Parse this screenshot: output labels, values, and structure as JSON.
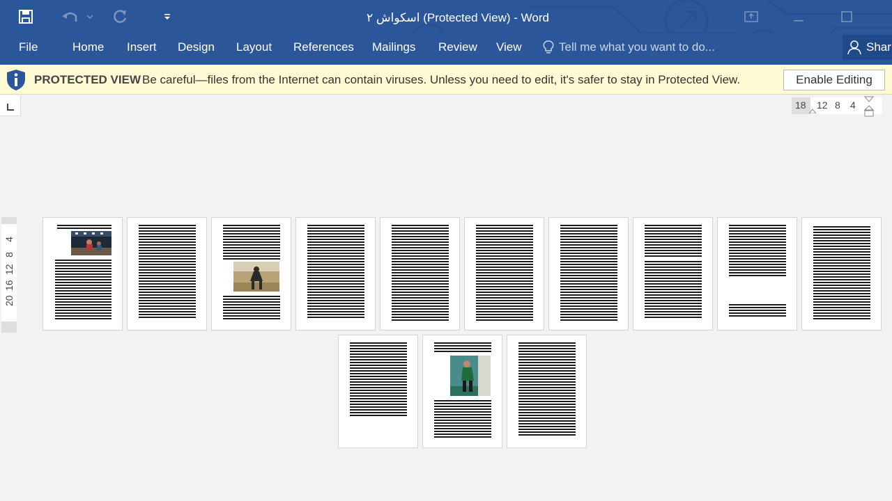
{
  "window": {
    "title": "اسکواش ۲ (Protected View) - Word",
    "colors": {
      "ribbon": "#2b579a",
      "protected_bar": "#fffbd5",
      "canvas": "#f2f2f2"
    }
  },
  "quick_access": {
    "icons": [
      "save-icon",
      "undo-icon",
      "undo-dropdown-icon",
      "redo-icon",
      "customize-qat-icon"
    ]
  },
  "window_controls": {
    "icons": [
      "ribbon-display-options-icon",
      "minimize-icon",
      "maximize-icon"
    ]
  },
  "ribbon": {
    "tabs": [
      "File",
      "Home",
      "Insert",
      "Design",
      "Layout",
      "References",
      "Mailings",
      "Review",
      "View"
    ],
    "tell_me": "Tell me what you want to do...",
    "share": "Shar"
  },
  "protected_view": {
    "title": "PROTECTED VIEW",
    "message": "Be careful—files from the Internet can contain viruses. Unless you need to edit, it's safer to stay in Protected View.",
    "button": "Enable Editing"
  },
  "rulers": {
    "horizontal": [
      "18",
      "12",
      "8",
      "4"
    ],
    "vertical": [
      "4",
      "8",
      "12",
      "16",
      "20"
    ]
  },
  "document": {
    "page_count": 13,
    "pages_with_photos": [
      1,
      3,
      12
    ]
  }
}
